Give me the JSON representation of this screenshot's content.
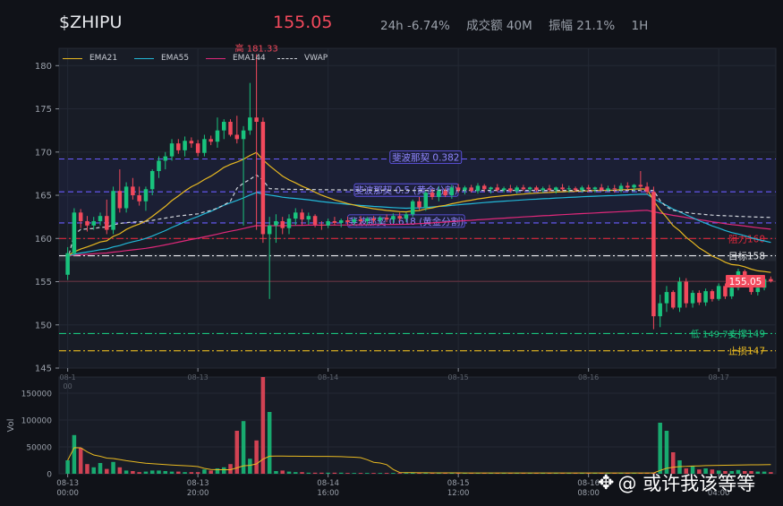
{
  "header": {
    "symbol": "$ZHIPU",
    "price": "155.05",
    "change": "24h -6.74%",
    "turnover": "成交额 40M",
    "amplitude": "振幅 21.1%",
    "interval": "1H"
  },
  "legend": [
    {
      "name": "EMA21",
      "color": "#e8b921",
      "dash": false
    },
    {
      "name": "EMA55",
      "color": "#22b8d8",
      "dash": false
    },
    {
      "name": "EMA144",
      "color": "#e0287a",
      "dash": false
    },
    {
      "name": "VWAP",
      "color": "#cfd3da",
      "dash": true
    }
  ],
  "watermark": {
    "text": "@ 或许我该等等",
    "icon": "weibo-camera-icon"
  },
  "chart_data": {
    "type": "candlestick",
    "ylim": [
      145,
      182
    ],
    "yticks": [
      145,
      150,
      155,
      160,
      165,
      170,
      175,
      180
    ],
    "volume_ylim": [
      0,
      180000
    ],
    "volume_ticks": [
      0,
      50000,
      100000,
      150000
    ],
    "volume_ylabel": "Vol",
    "x_tick_labels": [
      {
        "i": 0,
        "line1": "08-13",
        "line2": "00:00"
      },
      {
        "i": 20,
        "line1": "08-13",
        "line2": "20:00"
      },
      {
        "i": 40,
        "line1": "08-14",
        "line2": "16:00"
      },
      {
        "i": 60,
        "line1": "08-15",
        "line2": "12:00"
      },
      {
        "i": 80,
        "line1": "08-16",
        "line2": "08:00"
      },
      {
        "i": 100,
        "line1": "",
        "line2": "04:00"
      }
    ],
    "price_tick_labels": [
      {
        "i": 0,
        "line1": "08-1",
        "line2": "00"
      },
      {
        "i": 20,
        "line1": "08-13",
        "line2": ""
      },
      {
        "i": 40,
        "line1": "08-14",
        "line2": ""
      },
      {
        "i": 60,
        "line1": "08-15",
        "line2": ""
      },
      {
        "i": 80,
        "line1": "08-16",
        "line2": ""
      },
      {
        "i": 100,
        "line1": "08-17",
        "line2": ""
      }
    ],
    "levels": [
      {
        "value": 169.2,
        "label": "斐波那契 0.382",
        "color": "#6a5cff",
        "style": "dash",
        "label_pos": "mid",
        "label_at": 55
      },
      {
        "value": 165.4,
        "label": "斐波那契 0.5 (黄金分割)",
        "color": "#6a5cff",
        "style": "dash",
        "label_pos": "mid",
        "label_at": 52
      },
      {
        "value": 161.8,
        "label": "斐波那契 0.618 (黄金分割)",
        "color": "#6a5cff",
        "style": "dash",
        "label_pos": "mid",
        "label_at": 52
      },
      {
        "value": 160.0,
        "label": "阻力160",
        "color": "#e0283c",
        "style": "dashdot",
        "label_pos": "right"
      },
      {
        "value": 158.0,
        "label": "目标158",
        "color": "#e6e8ec",
        "style": "dashdot",
        "label_pos": "right"
      },
      {
        "value": 149.0,
        "label": "支撑149",
        "color": "#19c37d",
        "style": "dashdot",
        "label_pos": "right"
      },
      {
        "value": 147.0,
        "label": "止损147",
        "color": "#e8b921",
        "style": "dashdot",
        "label_pos": "right"
      }
    ],
    "annotations": [
      {
        "text": "高 181.33",
        "i": 29,
        "value": 181.33,
        "color": "#f2495c"
      },
      {
        "text": "低 149.74",
        "i": 99,
        "value": 149.74,
        "color": "#19c37d"
      }
    ],
    "last_price": {
      "value": 155.05,
      "label": "155.05",
      "color": "#f2495c"
    },
    "candles": [
      [
        155.8,
        159.0,
        155.2,
        158.3
      ],
      [
        158.3,
        163.5,
        158.0,
        163.0
      ],
      [
        163.0,
        163.4,
        161.2,
        162.0
      ],
      [
        162.0,
        162.6,
        160.8,
        161.5
      ],
      [
        161.5,
        162.5,
        161.0,
        162.0
      ],
      [
        162.0,
        163.0,
        161.5,
        162.6
      ],
      [
        162.6,
        164.5,
        160.5,
        161.0
      ],
      [
        161.0,
        166.0,
        160.5,
        165.5
      ],
      [
        165.5,
        168.0,
        163.0,
        163.5
      ],
      [
        163.5,
        166.5,
        163.0,
        166.0
      ],
      [
        166.0,
        167.0,
        164.5,
        165.0
      ],
      [
        165.0,
        166.0,
        163.8,
        164.3
      ],
      [
        164.3,
        166.0,
        163.2,
        165.7
      ],
      [
        165.7,
        168.0,
        165.0,
        167.8
      ],
      [
        167.8,
        169.5,
        167.0,
        169.0
      ],
      [
        169.0,
        170.0,
        168.0,
        169.5
      ],
      [
        169.5,
        171.5,
        169.0,
        171.0
      ],
      [
        171.0,
        171.5,
        169.8,
        170.2
      ],
      [
        170.2,
        171.8,
        169.5,
        171.3
      ],
      [
        171.3,
        171.7,
        170.5,
        171.0
      ],
      [
        171.0,
        171.4,
        169.5,
        169.9
      ],
      [
        169.9,
        172.0,
        169.5,
        171.5
      ],
      [
        171.5,
        171.9,
        170.8,
        171.2
      ],
      [
        171.2,
        174.0,
        170.5,
        172.5
      ],
      [
        172.5,
        173.8,
        171.5,
        173.5
      ],
      [
        173.5,
        173.8,
        171.8,
        172.0
      ],
      [
        172.0,
        174.2,
        171.0,
        171.5
      ],
      [
        171.5,
        173.0,
        161.5,
        172.5
      ],
      [
        172.5,
        178.0,
        172.0,
        174.0
      ],
      [
        174.0,
        181.33,
        161.0,
        173.5
      ],
      [
        173.5,
        174.0,
        159.5,
        160.5
      ],
      [
        160.5,
        162.5,
        153.0,
        161.5
      ],
      [
        161.5,
        162.8,
        159.5,
        162.0
      ],
      [
        162.0,
        162.5,
        160.5,
        161.2
      ],
      [
        161.2,
        162.8,
        160.5,
        162.3
      ],
      [
        162.3,
        163.5,
        161.5,
        163.0
      ],
      [
        163.0,
        163.4,
        161.5,
        162.2
      ],
      [
        162.2,
        163.0,
        161.6,
        162.6
      ],
      [
        162.6,
        162.8,
        161.3,
        161.6
      ],
      [
        161.6,
        162.0,
        161.0,
        161.5
      ],
      [
        161.5,
        162.3,
        161.2,
        162.0
      ],
      [
        162.0,
        162.5,
        161.5,
        161.8
      ],
      [
        161.8,
        162.3,
        161.3,
        162.1
      ],
      [
        162.1,
        162.5,
        161.6,
        161.9
      ],
      [
        161.9,
        162.4,
        161.5,
        162.2
      ],
      [
        162.2,
        162.6,
        161.7,
        162.0
      ],
      [
        162.0,
        162.5,
        161.6,
        162.3
      ],
      [
        162.3,
        162.6,
        161.8,
        162.1
      ],
      [
        162.1,
        162.6,
        161.7,
        162.4
      ],
      [
        162.4,
        162.8,
        161.9,
        162.2
      ],
      [
        162.2,
        162.9,
        161.8,
        162.6
      ],
      [
        162.6,
        163.0,
        162.0,
        162.3
      ],
      [
        162.3,
        163.0,
        161.9,
        162.8
      ],
      [
        162.8,
        164.5,
        162.5,
        164.3
      ],
      [
        164.3,
        164.8,
        163.3,
        163.6
      ],
      [
        163.6,
        165.5,
        163.2,
        165.3
      ],
      [
        165.3,
        165.7,
        164.5,
        164.8
      ],
      [
        164.8,
        166.0,
        164.3,
        165.5
      ],
      [
        165.5,
        165.8,
        164.8,
        165.0
      ],
      [
        165.0,
        166.2,
        164.6,
        165.9
      ],
      [
        165.9,
        166.3,
        165.3,
        165.6
      ],
      [
        165.6,
        166.1,
        165.1,
        165.9
      ],
      [
        165.9,
        166.2,
        165.3,
        165.5
      ],
      [
        165.5,
        166.4,
        165.2,
        166.1
      ],
      [
        166.1,
        166.3,
        165.4,
        165.7
      ],
      [
        165.7,
        166.0,
        165.2,
        165.9
      ],
      [
        165.9,
        166.3,
        165.4,
        165.6
      ],
      [
        165.6,
        166.0,
        165.3,
        165.8
      ],
      [
        165.8,
        166.2,
        165.3,
        165.5
      ],
      [
        165.5,
        166.1,
        165.2,
        165.9
      ],
      [
        165.9,
        166.2,
        165.5,
        165.7
      ],
      [
        165.7,
        166.0,
        165.3,
        165.9
      ],
      [
        165.9,
        166.1,
        165.4,
        165.6
      ],
      [
        165.6,
        166.0,
        165.3,
        165.8
      ],
      [
        165.8,
        166.2,
        165.4,
        165.6
      ],
      [
        165.6,
        166.0,
        165.2,
        165.9
      ],
      [
        165.9,
        166.3,
        165.5,
        165.7
      ],
      [
        165.7,
        166.1,
        165.3,
        165.8
      ],
      [
        165.8,
        166.0,
        165.4,
        165.6
      ],
      [
        165.6,
        166.1,
        165.3,
        165.9
      ],
      [
        165.9,
        166.2,
        165.4,
        165.7
      ],
      [
        165.7,
        166.0,
        165.3,
        165.9
      ],
      [
        165.9,
        166.3,
        165.5,
        165.6
      ],
      [
        165.6,
        166.1,
        165.4,
        165.8
      ],
      [
        165.8,
        166.2,
        165.3,
        165.7
      ],
      [
        165.7,
        166.4,
        165.3,
        166.1
      ],
      [
        166.1,
        166.5,
        165.6,
        165.9
      ],
      [
        165.9,
        166.3,
        165.4,
        166.2
      ],
      [
        166.2,
        167.8,
        165.5,
        166.0
      ],
      [
        166.0,
        166.5,
        165.1,
        165.4
      ],
      [
        165.4,
        166.0,
        149.5,
        151.0
      ],
      [
        151.0,
        153.5,
        149.74,
        152.5
      ],
      [
        152.5,
        154.5,
        151.5,
        153.8
      ],
      [
        153.8,
        154.0,
        151.8,
        152.0
      ],
      [
        152.0,
        155.5,
        151.5,
        155.0
      ],
      [
        155.0,
        155.4,
        152.0,
        152.5
      ],
      [
        152.5,
        154.0,
        152.0,
        153.7
      ],
      [
        153.7,
        154.0,
        152.3,
        152.6
      ],
      [
        152.6,
        154.2,
        152.2,
        153.9
      ],
      [
        153.9,
        154.1,
        152.7,
        153.0
      ],
      [
        153.0,
        154.8,
        152.8,
        154.5
      ],
      [
        154.5,
        154.8,
        153.0,
        153.3
      ],
      [
        153.3,
        154.5,
        153.0,
        154.3
      ],
      [
        154.3,
        156.5,
        154.0,
        156.2
      ],
      [
        156.2,
        156.4,
        154.5,
        154.8
      ],
      [
        154.8,
        155.2,
        153.5,
        153.8
      ],
      [
        153.8,
        154.6,
        153.4,
        154.3
      ],
      [
        154.3,
        155.5,
        154.0,
        155.3
      ],
      [
        155.3,
        155.6,
        154.9,
        155.05
      ]
    ],
    "volumes": [
      25000,
      72000,
      48000,
      18000,
      12000,
      20000,
      9000,
      22000,
      12000,
      6000,
      5000,
      3000,
      4000,
      6000,
      6000,
      5000,
      4000,
      4000,
      3000,
      3000,
      3000,
      8000,
      6000,
      10000,
      12000,
      18000,
      80000,
      98000,
      28000,
      62000,
      180000,
      115000,
      5000,
      6000,
      4000,
      3000,
      3000,
      2000,
      2000,
      2000,
      2000,
      2000,
      2000,
      1500,
      1500,
      1500,
      1500,
      1500,
      1500,
      1500,
      1500,
      1500,
      1500,
      2000,
      1500,
      2000,
      1500,
      1500,
      1500,
      1500,
      1500,
      1500,
      1500,
      1500,
      1500,
      1500,
      1500,
      1500,
      1500,
      1500,
      1500,
      1500,
      1500,
      1500,
      1500,
      1500,
      1500,
      1500,
      1500,
      1500,
      1500,
      1500,
      1500,
      1500,
      1500,
      1500,
      1500,
      1500,
      1500,
      2000,
      2000,
      95000,
      80000,
      40000,
      25000,
      10000,
      15000,
      8000,
      10000,
      8000,
      6000,
      5000,
      5000,
      7000,
      5000,
      5000,
      4000,
      4000,
      3000
    ]
  }
}
